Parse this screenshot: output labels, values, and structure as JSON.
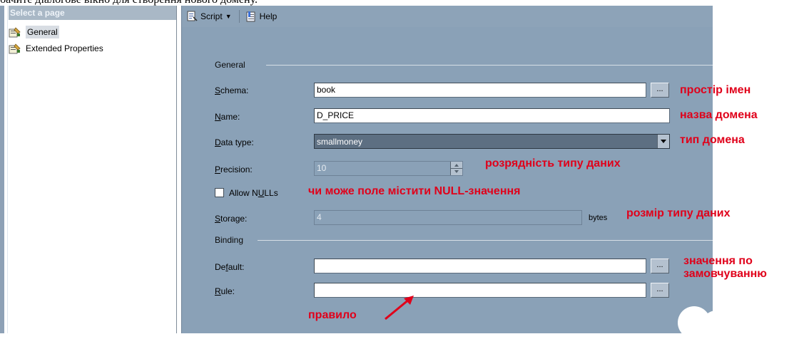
{
  "caption": "бачите діалогове вікно для створення нового домену.",
  "left_pane": {
    "header": "Select a page",
    "pages": [
      {
        "label": "General",
        "selected": true
      },
      {
        "label": "Extended Properties",
        "selected": false
      }
    ]
  },
  "toolbar": {
    "script_label": "Script",
    "help_label": "Help"
  },
  "groups": {
    "general": "General",
    "binding": "Binding"
  },
  "fields": {
    "schema": {
      "label_u": "S",
      "label_rest": "chema:",
      "value": "book"
    },
    "name": {
      "label_u": "N",
      "label_rest": "ame:",
      "value": "D_PRICE"
    },
    "data_type": {
      "label_u": "D",
      "label_rest": "ata type:",
      "value": "smallmoney"
    },
    "precision": {
      "label_u": "P",
      "label_rest": "recision:",
      "value": "10"
    },
    "allow_nulls": {
      "label_pre": "Allow N",
      "label_u": "U",
      "label_post": "LLs",
      "checked": false
    },
    "storage": {
      "label_u": "S",
      "label_rest": "torage:",
      "value": "4",
      "unit": "bytes"
    },
    "default": {
      "label_pre": "De",
      "label_u": "f",
      "label_post": "ault:",
      "value": ""
    },
    "rule": {
      "label_u": "R",
      "label_rest": "ule:",
      "value": ""
    }
  },
  "ellipsis": "...",
  "annotations": {
    "schema": "простір імен",
    "name": "назва домена",
    "data_type": "тип домена",
    "precision": "розрядність типу даних",
    "allow_nulls": "чи може поле містити NULL-значення",
    "storage": "розмір типу даних",
    "default": "значення по замовчуванню",
    "rule": "правило"
  },
  "colors": {
    "panel_bg": "#8aa1b7",
    "annotation_red": "#e0001a",
    "combo_selected_bg": "#5d6f82"
  },
  "icons": {
    "page_item": "properties-page-icon",
    "script": "script-icon",
    "help": "help-icon"
  }
}
